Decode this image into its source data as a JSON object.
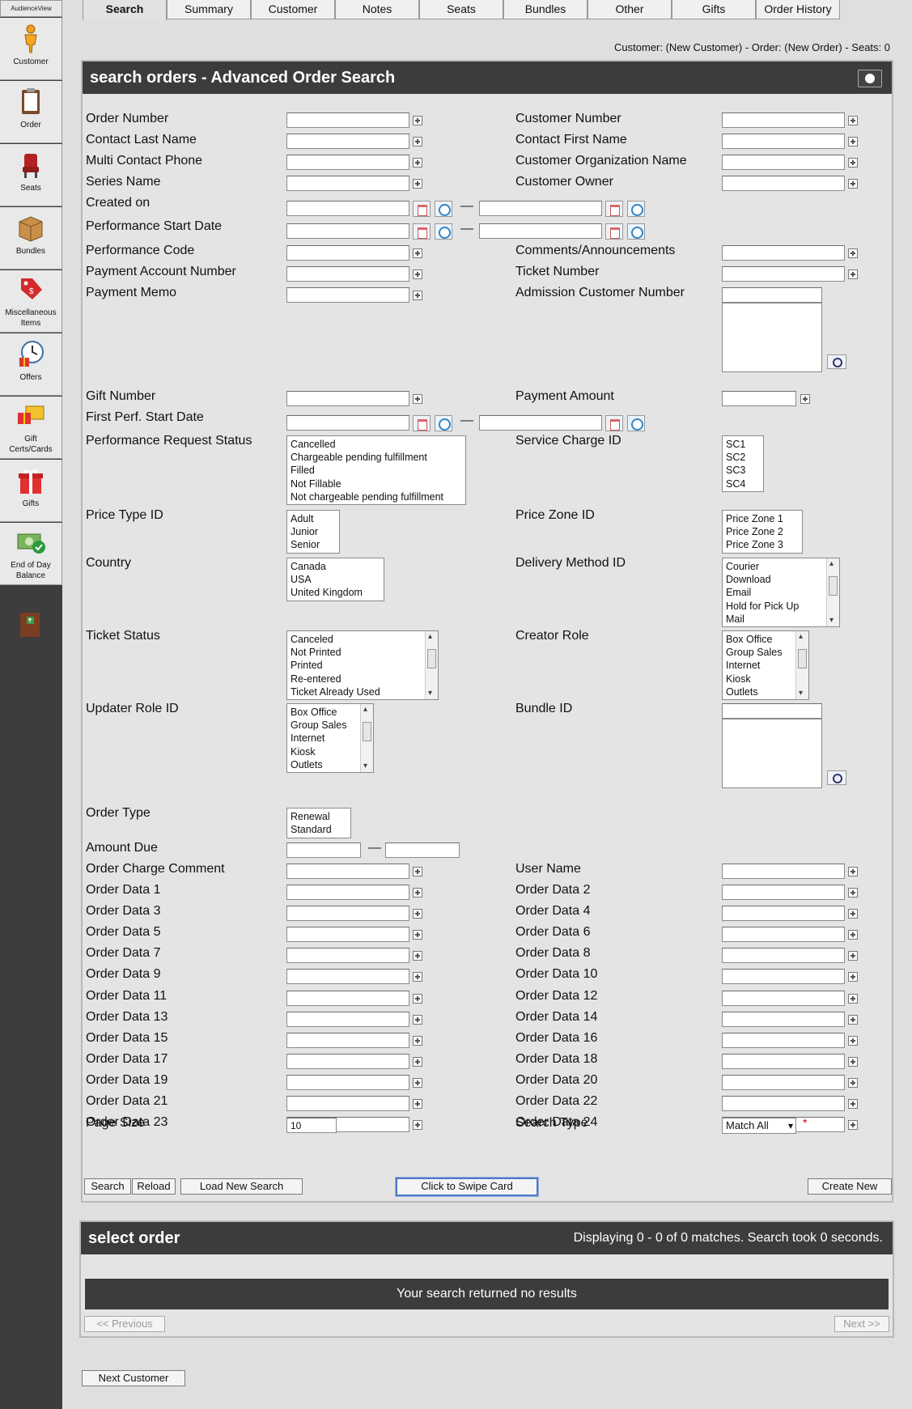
{
  "app": {
    "title": "AudienceView"
  },
  "sidebar": [
    {
      "label": "Customer"
    },
    {
      "label": "Order"
    },
    {
      "label": "Seats"
    },
    {
      "label": "Bundles"
    },
    {
      "label1": "Miscellaneous",
      "label2": "Items"
    },
    {
      "label": "Offers"
    },
    {
      "label1": "Gift",
      "label2": "Certs/Cards"
    },
    {
      "label": "Gifts"
    },
    {
      "label1": "End of Day",
      "label2": "Balance"
    }
  ],
  "tabs": [
    "Search",
    "Summary",
    "Customer",
    "Notes",
    "Seats",
    "Bundles",
    "Other",
    "Gifts",
    "Order History"
  ],
  "status_line": "Customer: (New Customer) - Order: (New Order) - Seats: 0",
  "search_panel": {
    "title": "search orders - Advanced Order Search",
    "labels": {
      "order_number": "Order Number",
      "customer_number": "Customer Number",
      "contact_last_name": "Contact Last Name",
      "contact_first_name": "Contact First Name",
      "multi_contact_phone": "Multi Contact Phone",
      "customer_org_name": "Customer Organization Name",
      "series_name": "Series Name",
      "customer_owner": "Customer Owner",
      "created_on": "Created on",
      "perf_start_date": "Performance Start Date",
      "performance_code": "Performance Code",
      "comments": "Comments/Announcements",
      "payment_account_number": "Payment Account Number",
      "ticket_number": "Ticket Number",
      "payment_memo": "Payment Memo",
      "admission_customer_number": "Admission Customer Number",
      "gift_number": "Gift Number",
      "payment_amount": "Payment Amount",
      "first_perf_start_date": "First Perf. Start Date",
      "perf_request_status": "Performance Request Status",
      "service_charge_id": "Service Charge ID",
      "price_type_id": "Price Type ID",
      "price_zone_id": "Price Zone ID",
      "country": "Country",
      "delivery_method_id": "Delivery Method ID",
      "ticket_status": "Ticket Status",
      "creator_role": "Creator Role",
      "updater_role_id": "Updater Role ID",
      "bundle_id": "Bundle ID",
      "order_type": "Order Type",
      "amount_due": "Amount Due",
      "order_charge_comment": "Order Charge Comment",
      "user_name": "User Name",
      "page_size": "Page Size",
      "search_type": "Search Type"
    },
    "order_data_rows": [
      [
        "Order Data 1",
        "Order Data 2"
      ],
      [
        "Order Data 3",
        "Order Data 4"
      ],
      [
        "Order Data 5",
        "Order Data 6"
      ],
      [
        "Order Data 7",
        "Order Data 8"
      ],
      [
        "Order Data 9",
        "Order Data 10"
      ],
      [
        "Order Data 11",
        "Order Data 12"
      ],
      [
        "Order Data 13",
        "Order Data 14"
      ],
      [
        "Order Data 15",
        "Order Data 16"
      ],
      [
        "Order Data 17",
        "Order Data 18"
      ],
      [
        "Order Data 19",
        "Order Data 20"
      ],
      [
        "Order Data 21",
        "Order Data 22"
      ],
      [
        "Order Data 23",
        "Order Data 24"
      ]
    ],
    "lists": {
      "perf_request_status": [
        "Cancelled",
        "Chargeable pending fulfillment",
        "Filled",
        "Not Fillable",
        "Not chargeable pending fulfillment"
      ],
      "service_charge_id": [
        "SC1",
        "SC2",
        "SC3",
        "SC4"
      ],
      "price_type_id": [
        "Adult",
        "Junior",
        "Senior"
      ],
      "price_zone_id": [
        "Price Zone 1",
        "Price Zone 2",
        "Price Zone 3"
      ],
      "country": [
        "Canada",
        "USA",
        "United Kingdom"
      ],
      "delivery_method_id": [
        "Courier",
        "Download",
        "Email",
        "Hold for Pick Up",
        "Mail"
      ],
      "ticket_status": [
        "Canceled",
        "Not Printed",
        "Printed",
        "Re-entered",
        "Ticket Already Used"
      ],
      "creator_role": [
        "Box Office",
        "Group Sales",
        "Internet",
        "Kiosk",
        "Outlets"
      ],
      "updater_role_id": [
        "Box Office",
        "Group Sales",
        "Internet",
        "Kiosk",
        "Outlets"
      ],
      "order_type": [
        "Renewal",
        "Standard"
      ]
    },
    "page_size_value": "10",
    "search_type_value": "Match All",
    "required_marker": "*",
    "buttons": {
      "search": "Search",
      "reload": "Reload",
      "load_new_search": "Load New Search",
      "swipe_card": "Click to Swipe Card",
      "create_new": "Create New"
    }
  },
  "results_panel": {
    "title": "select order",
    "summary": "Displaying 0 - 0 of 0 matches. Search took 0 seconds.",
    "empty_message": "Your search returned no results",
    "prev": "<< Previous",
    "next": "Next >>"
  },
  "next_customer": "Next Customer"
}
